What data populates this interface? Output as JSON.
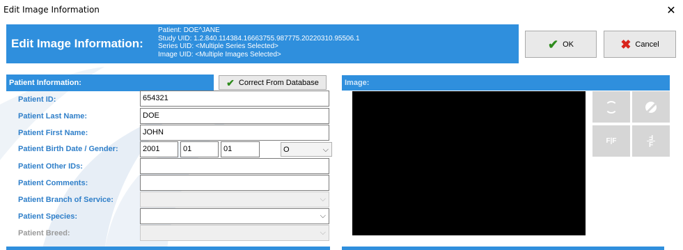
{
  "window": {
    "title": "Edit Image Information",
    "close_glyph": "✕"
  },
  "header": {
    "title": "Edit Image Information:",
    "patient": "Patient: DOE^JANE",
    "study_uid": "Study UID: 1.2.840.114384.16663755.987775.20220310.95506.1",
    "series_uid": "Series UID: <Multiple Series Selected>",
    "image_uid": "Image UID: <Multiple Images Selected>"
  },
  "actions": {
    "ok_label": "OK",
    "cancel_label": "Cancel",
    "ok_icon": "check-icon",
    "cancel_icon": "x-icon"
  },
  "patient_section": {
    "title": "Patient Information:",
    "correct_button": "Correct From Database",
    "fields": {
      "patient_id": {
        "label": "Patient ID:",
        "value": "654321"
      },
      "last_name": {
        "label": "Patient Last Name:",
        "value": "DOE"
      },
      "first_name": {
        "label": "Patient First Name:",
        "value": "JOHN"
      },
      "birth_gender": {
        "label": "Patient Birth Date / Gender:",
        "year": "2001",
        "month": "01",
        "day": "01",
        "gender": "O"
      },
      "other_ids": {
        "label": "Patient Other IDs:",
        "value": ""
      },
      "comments": {
        "label": "Patient Comments:",
        "value": ""
      },
      "branch": {
        "label": "Patient Branch of Service:",
        "value": ""
      },
      "species": {
        "label": "Patient Species:",
        "value": ""
      },
      "breed": {
        "label": "Patient Breed:",
        "value": ""
      }
    }
  },
  "image_section": {
    "title": "Image:",
    "tools": {
      "rotate_icon": "rotate-icon",
      "invert_icon": "invert-icon",
      "flip_h_label": "F|F",
      "flip_v_label": "F"
    }
  },
  "colors": {
    "accent": "#2f8fdd",
    "label": "#2f7fc9",
    "ok_check": "#2e8b1d",
    "cancel_x": "#d8241c"
  }
}
